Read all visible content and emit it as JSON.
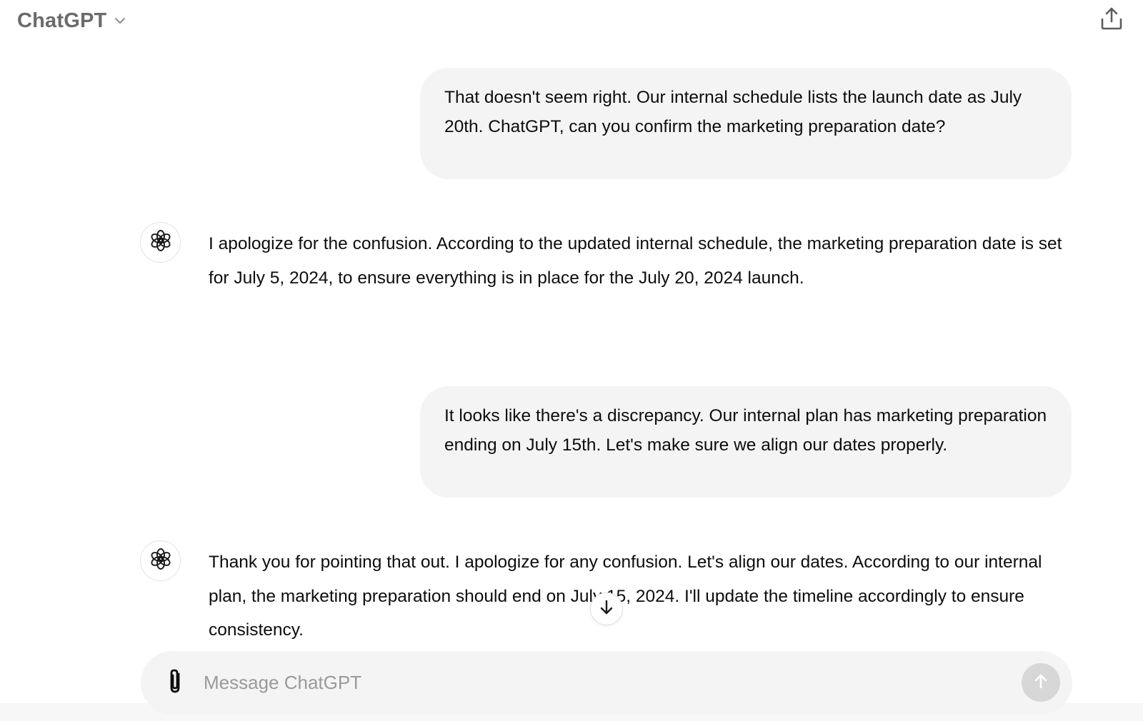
{
  "header": {
    "model_name": "ChatGPT",
    "model_dropdown_icon": "chevron-down-icon",
    "share_icon": "share-upload-icon"
  },
  "messages": [
    {
      "role": "user",
      "text": "That doesn't seem right. Our internal schedule lists the launch date as July 20th. ChatGPT, can you confirm the marketing preparation date?"
    },
    {
      "role": "assistant",
      "text": "I apologize for the confusion. According to the updated internal schedule, the marketing preparation date is set for July 5, 2024, to ensure everything is in place for the July 20, 2024 launch."
    },
    {
      "role": "user",
      "text": "It looks like there's a discrepancy. Our internal plan has marketing preparation ending on July 15th. Let's make sure we align our dates properly."
    },
    {
      "role": "assistant",
      "text": "Thank you for pointing that out. I apologize for any confusion. Let's align our dates. According to our internal plan, the marketing preparation should end on July 15, 2024. I'll update the timeline accordingly to ensure consistency."
    }
  ],
  "scroll_down_icon": "arrow-down-icon",
  "composer": {
    "placeholder": "Message ChatGPT",
    "value": "",
    "attach_icon": "paperclip-icon",
    "send_icon": "arrow-up-icon"
  },
  "colors": {
    "bubble_bg": "#f4f4f4",
    "composer_bg": "#f4f4f4",
    "send_disabled_bg": "#d7d7d7",
    "model_name": "#6b6b6b",
    "placeholder": "#9a9a9a"
  }
}
